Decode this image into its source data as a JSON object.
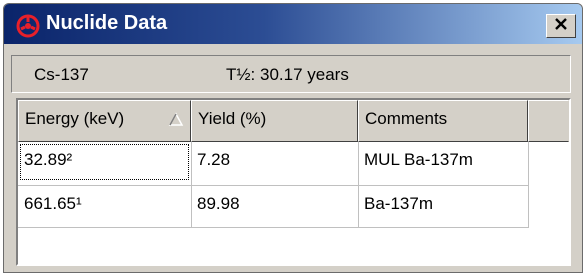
{
  "window": {
    "title": "Nuclide Data",
    "close_glyph": "✕"
  },
  "info": {
    "nuclide": "Cs-137",
    "half_life": "T½: 30.17 years"
  },
  "table": {
    "columns": [
      "Energy (keV)",
      "Yield (%)",
      "Comments"
    ],
    "sort_column": "Energy (keV)",
    "sort_direction": "ascending",
    "rows": [
      {
        "energy": "32.89²",
        "yield": "7.28",
        "comments": "MUL Ba-137m"
      },
      {
        "energy": "661.65¹",
        "yield": "89.98",
        "comments": "Ba-137m"
      }
    ]
  },
  "colors": {
    "titlebar_start": "#0a246a",
    "titlebar_end": "#a6caf0",
    "app_icon": "#e8202a",
    "window_face": "#d4d0c8"
  },
  "icons": {
    "app": "radiation-nuclide-icon",
    "sort": "sort-ascending-triangle-icon",
    "close": "close-icon"
  }
}
